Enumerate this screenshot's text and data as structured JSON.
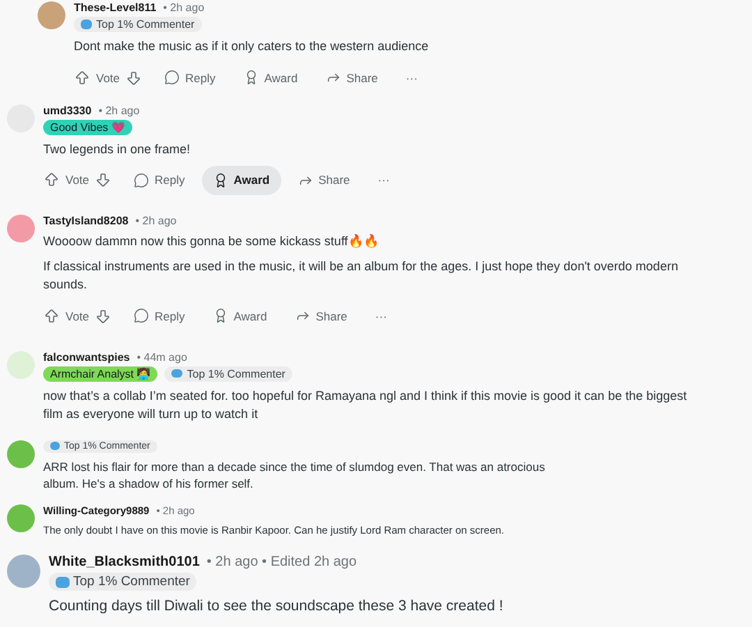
{
  "comments": [
    {
      "kind": "nested",
      "user": "These-Level811",
      "meta": "• 2h ago",
      "color": "#c9a27a",
      "flairs": [
        {
          "kind": "badge",
          "text": "Top 1% Commenter",
          "color": "#ececec"
        }
      ],
      "paragraphs": [
        "Dont make the music as if it only caters to the western audience"
      ],
      "actions": [
        {
          "kind": "upvote",
          "label": "Vote",
          "selected": false
        },
        {
          "kind": "reply",
          "label": "Reply",
          "selected": false
        },
        {
          "kind": "award",
          "label": "Award",
          "selected": false
        },
        {
          "kind": "share",
          "label": "Share",
          "selected": false
        },
        {
          "kind": "more",
          "label": "···",
          "selected": false
        }
      ]
    },
    {
      "kind": "normal",
      "user": "umd3330",
      "meta": "• 2h ago",
      "color": "#e8e8e8",
      "flairs": [
        {
          "kind": "flair",
          "text": "Good Vibes 💗",
          "color": "#2ed3b7"
        }
      ],
      "paragraphs": [
        "Two legends in one frame!"
      ],
      "actions": [
        {
          "kind": "upvote",
          "label": "Vote",
          "selected": false
        },
        {
          "kind": "reply",
          "label": "Reply",
          "selected": false
        },
        {
          "kind": "award",
          "label": "Award",
          "selected": true
        },
        {
          "kind": "share",
          "label": "Share",
          "selected": false
        },
        {
          "kind": "more",
          "label": "···",
          "selected": false
        }
      ]
    },
    {
      "kind": "normal",
      "user": "TastyIsland8208",
      "meta": "• 2h ago",
      "color": "#f29aa6",
      "paragraphs": [
        "Woooow dammn now this gonna be some kickass stuff🔥🔥",
        "If classical instruments are used in the music, it will be an album for the ages. I just hope they don't overdo modern sounds."
      ],
      "actions": [
        {
          "kind": "upvote",
          "label": "Vote",
          "selected": false
        },
        {
          "kind": "reply",
          "label": "Reply",
          "selected": false
        },
        {
          "kind": "award",
          "label": "Award",
          "selected": false
        },
        {
          "kind": "share",
          "label": "Share",
          "selected": false
        },
        {
          "kind": "more",
          "label": "···",
          "selected": false
        }
      ]
    },
    {
      "kind": "normal",
      "user": "falconwantspies",
      "meta": "• 44m ago",
      "color": "#dff2d8",
      "flairs": [
        {
          "kind": "flair",
          "text": "Armchair Analyst 🧑‍💻",
          "color": "#7ed957"
        },
        {
          "kind": "badge",
          "text": "Top 1% Commenter",
          "color": "#ececec"
        }
      ],
      "paragraphs": [
        "now that’s a collab I’m seated for. too hopeful for Ramayana ngl and I think if this movie is good it can be the biggest film as everyone will turn up to watch it"
      ]
    },
    {
      "kind": "small",
      "color": "#6cc04a",
      "flairs": [
        {
          "kind": "badge",
          "text": "Top 1% Commenter",
          "color": "#ececec"
        }
      ],
      "paragraphs": [
        "ARR lost his flair for more than a decade since the time of slumdog even. That was an atrocious album. He's a shadow of his former self."
      ]
    },
    {
      "kind": "tiny",
      "user": "Willing-Category9889",
      "meta": "• 2h ago",
      "color": "#6cc04a",
      "paragraphs": [
        "The only doubt I have on this movie is Ranbir Kapoor. Can he justify Lord Ram character on screen."
      ]
    },
    {
      "kind": "large",
      "user": "White_Blacksmith0101",
      "meta": "• 2h ago • Edited 2h ago",
      "color": "#9fb3c8",
      "flairs": [
        {
          "kind": "badge",
          "text": "Top 1% Commenter",
          "color": "#ececec"
        }
      ],
      "paragraphs": [
        "Counting days till Diwali to see the soundscape these 3 have created !"
      ]
    }
  ]
}
